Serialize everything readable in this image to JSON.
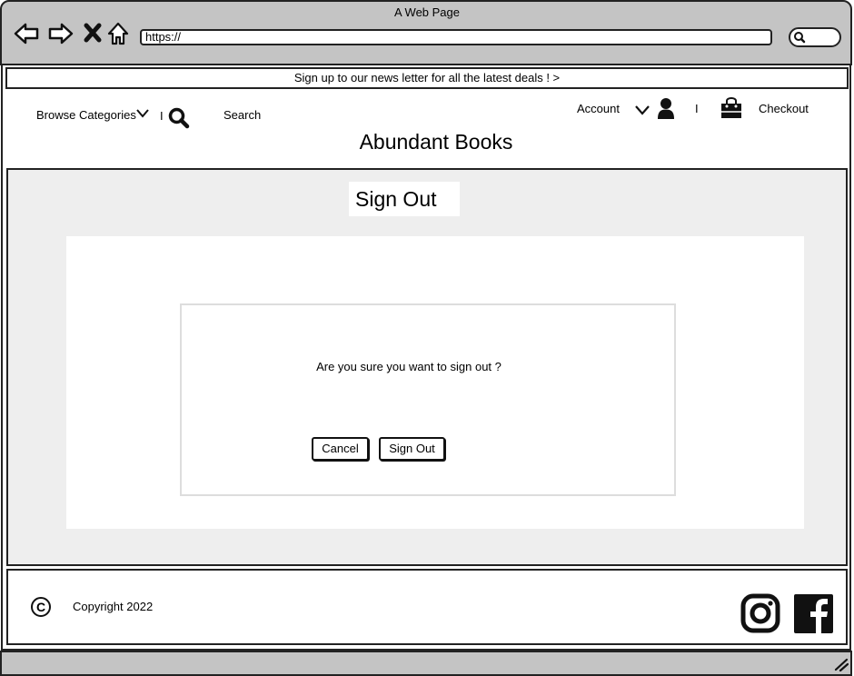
{
  "browser": {
    "window_title": "A Web Page",
    "url": "https://"
  },
  "newsletter": {
    "text": "Sign up to our news letter for all the latest deals !  >"
  },
  "header": {
    "browse_categories": "Browse Categories",
    "separator": "I",
    "search_label": "Search",
    "account_label": "Account",
    "checkout_label": "Checkout",
    "brand_name": "Abundant Books"
  },
  "main": {
    "page_title": "Sign Out",
    "dialog": {
      "message": "Are you sure you want to sign out ?",
      "cancel_label": "Cancel",
      "sign_out_label": "Sign Out"
    }
  },
  "footer": {
    "copyright_symbol": "C",
    "copyright_text": "Copyright 2022"
  },
  "icons": [
    "back-arrow-icon",
    "forward-arrow-icon",
    "close-icon",
    "home-icon",
    "search-icon",
    "chevron-down-icon",
    "user-icon",
    "shopping-bag-icon",
    "copyright-icon",
    "instagram-icon",
    "facebook-icon",
    "resize-grip-icon"
  ]
}
